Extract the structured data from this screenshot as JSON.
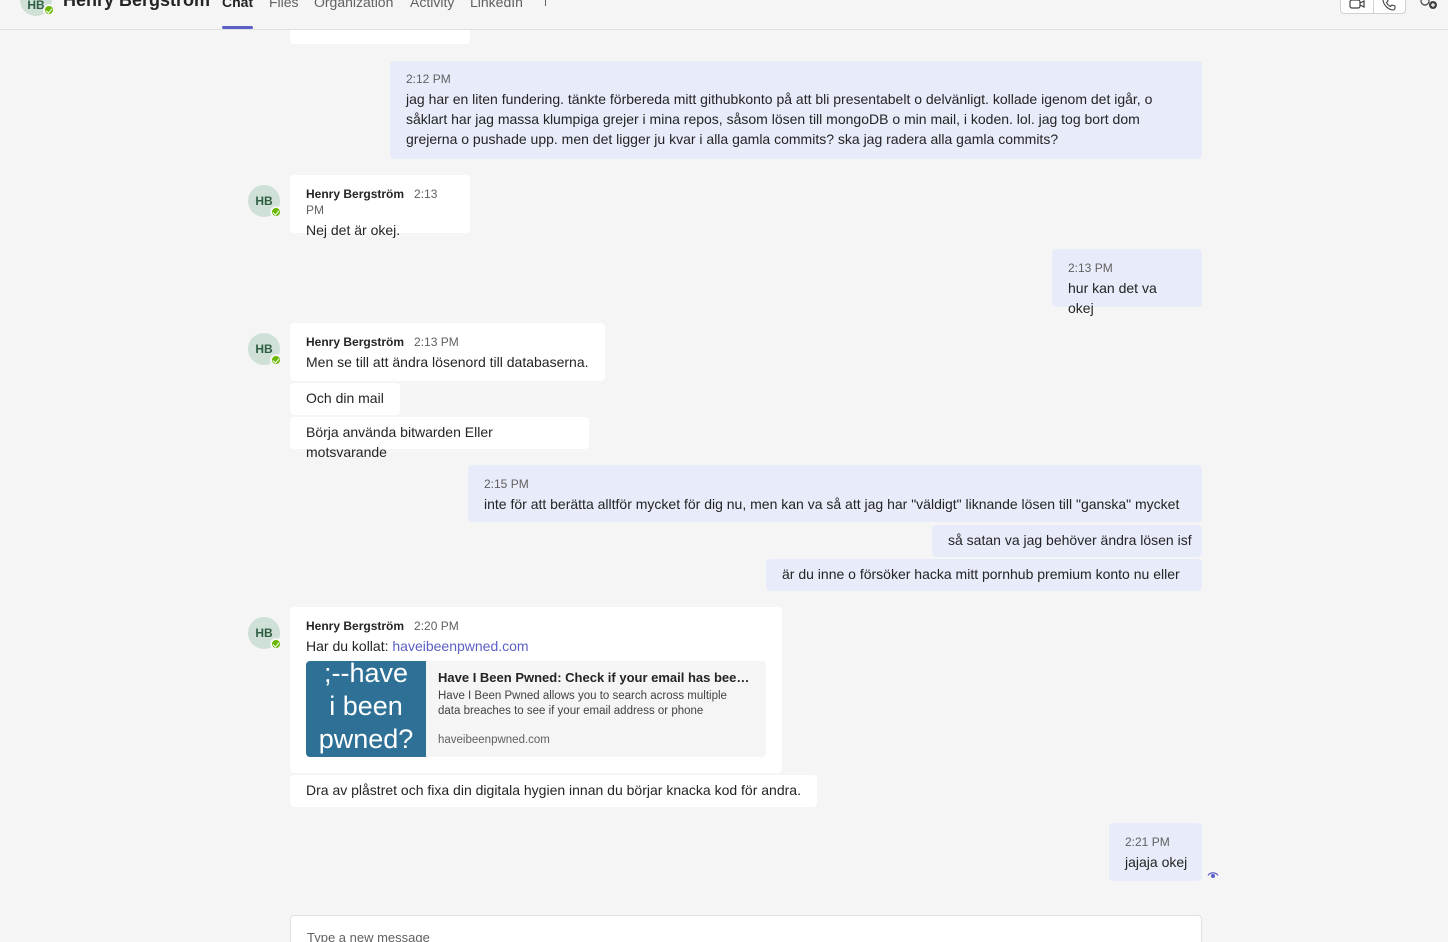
{
  "header": {
    "avatar_initials": "HB",
    "contact_name": "Henry Bergström",
    "tabs": [
      {
        "label": "Chat",
        "active": true
      },
      {
        "label": "Files"
      },
      {
        "label": "Organization"
      },
      {
        "label": "Activity"
      },
      {
        "label": "LinkedIn"
      }
    ],
    "actions": [
      "video-call-icon",
      "audio-call-icon",
      "add-people-icon"
    ]
  },
  "messages": [
    {
      "time": "2:12 PM",
      "text": "jag har en liten fundering. tänkte förbereda mitt githubkonto på att bli presentabelt o delvänligt. kollade igenom det igår, o såklart har jag massa klumpiga grejer i mina repos, såsom lösen till mongoDB o min mail, i koden. lol. jag tog bort dom grejerna o pushade upp. men det ligger ju kvar i alla gamla commits? ska jag radera alla gamla commits?"
    },
    {
      "sender": "Henry Bergström",
      "initials": "HB",
      "time": "2:13 PM",
      "text": "Nej det är okej."
    },
    {
      "time": "2:13 PM",
      "text": "hur kan det va okej"
    },
    {
      "sender": "Henry Bergström",
      "initials": "HB",
      "time": "2:13 PM",
      "text": "Men se till att ändra lösenord till databaserna."
    },
    {
      "text": "Och din mail"
    },
    {
      "text": "Börja använda bitwarden Eller motsvarande"
    },
    {
      "time": "2:15 PM",
      "text": "inte för att berätta alltför mycket för dig nu, men kan va så att jag har \"väldigt\" liknande lösen till \"ganska\" mycket"
    },
    {
      "text": "så satan va jag behöver ändra lösen isf"
    },
    {
      "text": "är du inne o försöker hacka mitt pornhub premium konto nu eller"
    },
    {
      "sender": "Henry Bergström",
      "initials": "HB",
      "time": "2:20 PM",
      "text_prefix": "Har du kollat: ",
      "link": "haveibeenpwned.com",
      "card": {
        "image_lines": [
          ";--have",
          "i been",
          "pwned?"
        ],
        "title": "Have I Been Pwned: Check if your email has been compromised in a data breach",
        "description": "Have I Been Pwned allows you to search across multiple data breaches to see if your email address or phone number has been compromised.",
        "domain": "haveibeenpwned.com"
      }
    },
    {
      "text": "Dra av plåstret och fixa din digitala hygien innan du börjar knacka kod för andra."
    },
    {
      "time": "2:21 PM",
      "text": "jajaja okej"
    }
  ],
  "composer": {
    "placeholder": "Type a new message"
  },
  "colors": {
    "accent": "#5b5fc7",
    "outgoing_bubble": "#e8ebfa",
    "incoming_bubble": "#ffffff",
    "presence_available": "#6bb700",
    "link_card_image": "#2f7196"
  }
}
